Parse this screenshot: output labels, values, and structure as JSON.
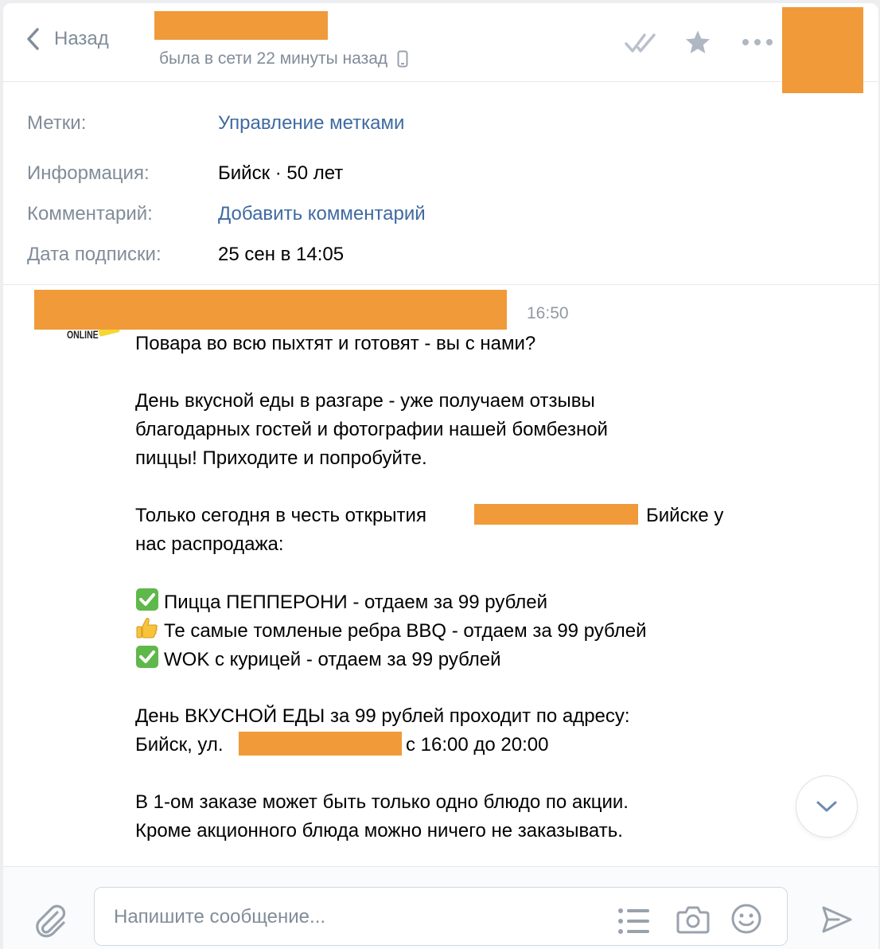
{
  "header": {
    "back_label": "Назад",
    "status": "была в сети 22 минуты назад"
  },
  "info": {
    "labels_key": "Метки:",
    "labels_value": "Управление метками",
    "info_key": "Информация:",
    "info_value": "Бийск · 50 лет",
    "comment_key": "Комментарий:",
    "comment_value": "Добавить комментарий",
    "subscribe_key": "Дата подписки:",
    "subscribe_value": "25 сен в 14:05"
  },
  "message": {
    "time": "16:50",
    "avatar_text": "ONLINE",
    "line1": "Повара во всю пыхтят и готовят - вы с нами?",
    "para2_line1": "День вкусной еды в разгаре - уже получаем отзывы",
    "para2_line2": "благодарных гостей и фотографии нашей бомбезной",
    "para2_line3": "пиццы! Приходите и попробуйте.",
    "para3_start": "Только сегодня в честь открытия",
    "para3_end": "Бийске у",
    "para3_line2": "нас распродажа:",
    "item1": "Пицца ПЕППЕРОНИ - отдаем за 99 рублей",
    "item2": "Те самые томленые ребра BBQ - отдаем за 99 рублей",
    "item3": "WOK с курицей - отдаем за 99 рублей",
    "para5_line1": "День ВКУСНОЙ ЕДЫ за 99 рублей проходит по адресу:",
    "para5_start": "Бийск, ул.",
    "para5_end": "с 16:00 до 20:00",
    "para6_line1": "В 1-ом заказе может быть только одно блюдо по акции.",
    "para6_line2": "Кроме акционного блюда можно ничего не заказывать."
  },
  "composer": {
    "placeholder": "Напишите сообщение..."
  },
  "colors": {
    "link": "#3f6aa1",
    "muted": "#818c99",
    "redaction": "#f09a3a"
  },
  "icons": [
    "chevron-left-icon",
    "phone-icon",
    "double-check-icon",
    "star-icon",
    "more-icon",
    "paperclip-icon",
    "templates-icon",
    "camera-icon",
    "smile-icon",
    "send-icon",
    "chevron-down-icon",
    "check-emoji-icon",
    "thumbs-up-emoji-icon"
  ]
}
